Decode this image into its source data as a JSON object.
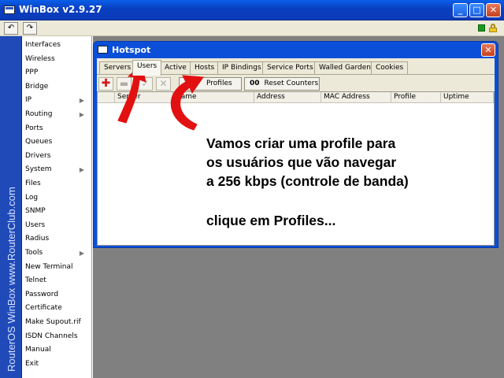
{
  "app": {
    "title": "WinBox v2.9.27"
  },
  "brand": {
    "text": "RouterOS WinBox   www.RouterClub.com"
  },
  "menu": [
    {
      "label": "Interfaces",
      "sub": false
    },
    {
      "label": "Wireless",
      "sub": false
    },
    {
      "label": "PPP",
      "sub": false
    },
    {
      "label": "Bridge",
      "sub": false
    },
    {
      "label": "IP",
      "sub": true
    },
    {
      "label": "Routing",
      "sub": true
    },
    {
      "label": "Ports",
      "sub": false
    },
    {
      "label": "Queues",
      "sub": false
    },
    {
      "label": "Drivers",
      "sub": false
    },
    {
      "label": "System",
      "sub": true
    },
    {
      "label": "Files",
      "sub": false
    },
    {
      "label": "Log",
      "sub": false
    },
    {
      "label": "SNMP",
      "sub": false
    },
    {
      "label": "Users",
      "sub": false
    },
    {
      "label": "Radius",
      "sub": false
    },
    {
      "label": "Tools",
      "sub": true
    },
    {
      "label": "New Terminal",
      "sub": false
    },
    {
      "label": "Telnet",
      "sub": false
    },
    {
      "label": "Password",
      "sub": false
    },
    {
      "label": "Certificate",
      "sub": false
    },
    {
      "label": "Make Supout.rif",
      "sub": false
    },
    {
      "label": "ISDN Channels",
      "sub": false
    },
    {
      "label": "Manual",
      "sub": false
    },
    {
      "label": "Exit",
      "sub": false
    }
  ],
  "hotspot": {
    "title": "Hotspot",
    "tabs": [
      "Servers",
      "Users",
      "Active",
      "Hosts",
      "IP Bindings",
      "Service Ports",
      "Walled Garden",
      "Cookies"
    ],
    "active_tab": "Users",
    "buttons": {
      "profiles": "Profiles",
      "reset_icon": "00",
      "reset": "Reset Counters"
    },
    "columns": [
      "Server",
      "Name",
      "Address",
      "MAC Address",
      "Profile",
      "Uptime"
    ]
  },
  "annotation": {
    "lines": [
      "Vamos criar uma profile para",
      "os usuários que vão navegar",
      "a 256 kbps (controle de banda)",
      "",
      "clique em Profiles..."
    ],
    "arrow_color": "#e21010"
  },
  "colors": {
    "titlebar": "#0a4fd8",
    "workspace": "#808080",
    "brand_strip": "#1f4ab8"
  }
}
